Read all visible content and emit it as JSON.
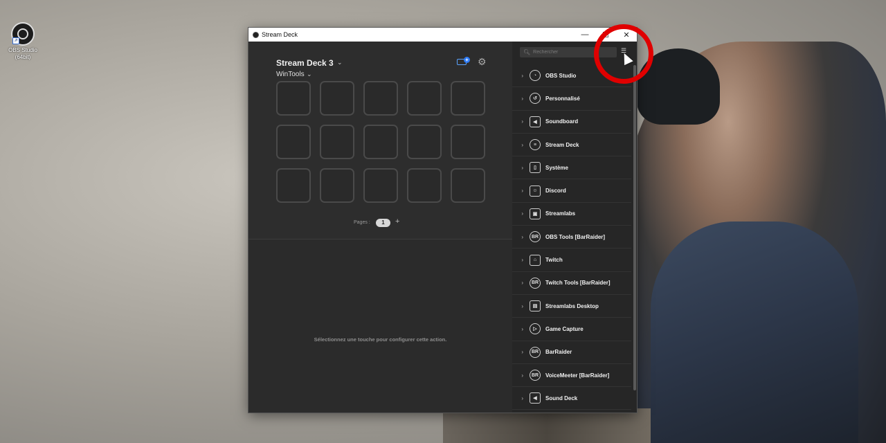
{
  "desktop": {
    "icon_label": "OBS Studio\n(64bit)"
  },
  "window": {
    "title": "Stream Deck",
    "minimize": "—",
    "maximize": "☐",
    "close": "✕"
  },
  "deck": {
    "name": "Stream Deck 3",
    "profile": "WinTools",
    "pages_label": "Pages :",
    "current_page": "1",
    "add_page": "+",
    "hint": "Sélectionnez une touche pour configurer cette action."
  },
  "search": {
    "placeholder": "Rechercher"
  },
  "categories": [
    {
      "label": "OBS Studio",
      "icon": "obs-icon",
      "glyph": "◔"
    },
    {
      "label": "Personnalisé",
      "icon": "custom-icon",
      "glyph": "↺"
    },
    {
      "label": "Soundboard",
      "icon": "speaker-icon",
      "glyph": "◀"
    },
    {
      "label": "Stream Deck",
      "icon": "stream-deck-icon",
      "glyph": "≡"
    },
    {
      "label": "Système",
      "icon": "system-icon",
      "glyph": "▯"
    },
    {
      "label": "Discord",
      "icon": "discord-icon",
      "glyph": "☺"
    },
    {
      "label": "Streamlabs",
      "icon": "streamlabs-icon",
      "glyph": "▣"
    },
    {
      "label": "OBS Tools [BarRaider]",
      "icon": "barraider-icon",
      "glyph": "BR"
    },
    {
      "label": "Twitch",
      "icon": "twitch-icon",
      "glyph": "⌂"
    },
    {
      "label": "Twitch Tools [BarRaider]",
      "icon": "barraider-icon",
      "glyph": "BR"
    },
    {
      "label": "Streamlabs Desktop",
      "icon": "streamlabs-desktop-icon",
      "glyph": "▤"
    },
    {
      "label": "Game Capture",
      "icon": "play-icon",
      "glyph": "▷"
    },
    {
      "label": "BarRaider",
      "icon": "barraider-icon",
      "glyph": "BR"
    },
    {
      "label": "VoiceMeeter [BarRaider]",
      "icon": "barraider-icon",
      "glyph": "BR"
    },
    {
      "label": "Sound Deck",
      "icon": "sound-deck-icon",
      "glyph": "◀"
    }
  ],
  "colors": {
    "highlight_circle": "#e00000",
    "accent_blue": "#2f7cf6"
  }
}
